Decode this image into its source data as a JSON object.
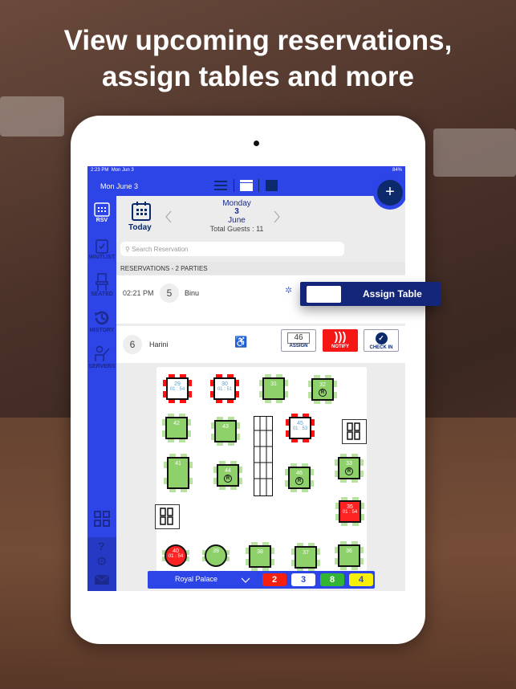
{
  "headline": {
    "line1": "View upcoming reservations,",
    "line2": "assign tables and more"
  },
  "status_bar": {
    "time": "2:23 PM",
    "date": "Mon Jun 3",
    "battery": "84%"
  },
  "top_bar": {
    "date": "Mon June 3",
    "add_label": "+",
    "view_icons": [
      "list-icon",
      "split-view-icon",
      "grid-view-icon"
    ]
  },
  "sidebar": {
    "items": [
      {
        "label": "RSV",
        "icon": "calendar-icon",
        "active": true
      },
      {
        "label": "WAITLIST",
        "icon": "clipboard-icon"
      },
      {
        "label": "SEATED",
        "icon": "chair-icon"
      },
      {
        "label": "HISTORY",
        "icon": "history-icon"
      },
      {
        "label": "SERVERS",
        "icon": "server-person-icon"
      }
    ],
    "bottom": [
      "grid-icon",
      "help-icon",
      "gear-icon",
      "mail-icon"
    ]
  },
  "date_nav": {
    "today": "Today",
    "weekday": "Monday",
    "day": "3",
    "month": "June",
    "total_guests": "Total Guests : 11"
  },
  "search": {
    "placeholder": "Search Reservation"
  },
  "section_header": "RESERVATIONS - 2 PARTIES",
  "reservations": [
    {
      "time": "02:21 PM",
      "party": "5",
      "name": "Binu"
    },
    {
      "party": "6",
      "name": "Harini",
      "table": "46",
      "assign": "ASSIGN",
      "notify": "NOTIFY",
      "checkin": "CHECK IN"
    }
  ],
  "assign_popup": {
    "label": "Assign Table"
  },
  "tables": [
    {
      "id": "29",
      "status": "occupied",
      "timer": "01 : 54"
    },
    {
      "id": "30",
      "status": "occupied",
      "timer": "01 : 51"
    },
    {
      "id": "31",
      "status": "available"
    },
    {
      "id": "32",
      "status": "available",
      "reserved": true
    },
    {
      "id": "42",
      "status": "available"
    },
    {
      "id": "43",
      "status": "available"
    },
    {
      "id": "45",
      "status": "occupied",
      "timer": "01 : 53"
    },
    {
      "id": "41",
      "status": "available"
    },
    {
      "id": "44",
      "status": "available",
      "reserved": true
    },
    {
      "id": "46",
      "status": "available",
      "reserved": true
    },
    {
      "id": "33",
      "status": "available",
      "reserved": true
    },
    {
      "id": "35",
      "status": "seated-over",
      "timer": "01 : 54"
    },
    {
      "id": "40",
      "status": "seated-over",
      "timer": "01 : 54",
      "shape": "round"
    },
    {
      "id": "39",
      "status": "available",
      "shape": "round"
    },
    {
      "id": "38",
      "status": "available"
    },
    {
      "id": "37",
      "status": "available"
    },
    {
      "id": "36",
      "status": "available"
    }
  ],
  "floor_bar": {
    "room": "Royal Palace",
    "counts": [
      {
        "value": "2",
        "color": "#f5200f",
        "text": "#ffffff"
      },
      {
        "value": "3",
        "color": "#ffffff",
        "text": "#2d44e6"
      },
      {
        "value": "8",
        "color": "#33b533",
        "text": "#ffffff"
      },
      {
        "value": "4",
        "color": "#f5ef0a",
        "text": "#2d44e6"
      }
    ]
  },
  "colors": {
    "primary": "#2d44e6",
    "dark": "#0c2a6b",
    "available": "#8ed06a",
    "alert": "#f22222"
  }
}
